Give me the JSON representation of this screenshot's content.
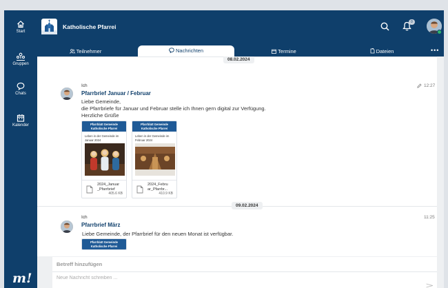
{
  "sidebar": {
    "items": [
      {
        "label": "Start",
        "icon": "home-icon"
      },
      {
        "label": "Gruppen",
        "icon": "groups-icon"
      },
      {
        "label": "Chats",
        "icon": "chat-icon"
      },
      {
        "label": "Kalender",
        "icon": "calendar-icon"
      }
    ],
    "logo": "m!"
  },
  "header": {
    "title": "Katholische Pfarrei",
    "notification_count": "0"
  },
  "tabs": [
    {
      "label": "Teilnehmer",
      "icon": "people-icon",
      "active": false
    },
    {
      "label": "Nachrichten",
      "icon": "chat-bubble-icon",
      "active": true
    },
    {
      "label": "Termine",
      "icon": "calendar-icon",
      "active": false
    },
    {
      "label": "Dateien",
      "icon": "files-icon",
      "active": false
    }
  ],
  "tabs_more": "•••",
  "messages": [
    {
      "date": "08.02.2024",
      "sender": "Ich",
      "subject": "Pfarrbrief Januar / Februar",
      "time": "12:27",
      "body": [
        "Liebe Gemeinde,",
        "die Pfarrbriefe für Januar und Februar stelle ich Ihnen gern digital zur Verfügung.",
        "Herzliche Grüße"
      ],
      "attachments": [
        {
          "header": "Pfarrblatt Gemeinde Katholische Pfarrei",
          "subtitle": "Leben in der Gemeinde im Januar 2024",
          "filename": "2024_Januar _Pfarrbrief",
          "size": "405.6 KB"
        },
        {
          "header": "Pfarrblatt Gemeinde Katholische Pfarrei",
          "subtitle": "Leben in der Gemeinde im Februar 2024",
          "filename": "2024_Febru ar_Pfarrbr...",
          "size": "410.9 KB"
        }
      ]
    },
    {
      "date": "09.02.2024",
      "sender": "Ich",
      "subject": "Pfarrbrief März",
      "time": "11:25",
      "body": [
        "Liebe Gemeinde, der Pfarrbrief für den neuen Monat ist verfügbar."
      ],
      "attachments": [
        {
          "header": "Pfarrblatt Gemeinde Katholische Pfarrei"
        }
      ]
    }
  ],
  "composer": {
    "subject_placeholder": "Betreff hinzufügen",
    "message_placeholder": "Neue Nachricht schreiben ..."
  },
  "colors": {
    "brand": "#0f3f6b",
    "card_header": "#1f5a96",
    "online": "#2fb36a"
  }
}
